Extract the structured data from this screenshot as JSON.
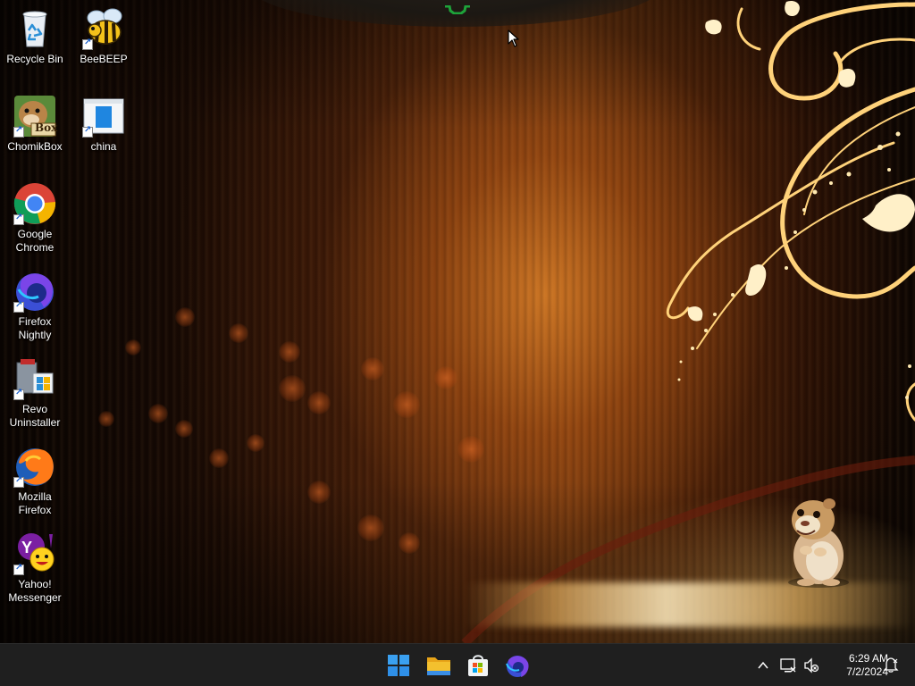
{
  "desktop": {
    "icons": [
      {
        "label": "Recycle Bin",
        "icon": "recycle-bin-icon",
        "shortcut": false
      },
      {
        "label": "BeeBEEP",
        "icon": "bee-icon",
        "shortcut": true
      },
      {
        "label": "ChomikBox",
        "icon": "hamster-box-icon",
        "shortcut": true
      },
      {
        "label": "china",
        "icon": "document-icon",
        "shortcut": true
      },
      {
        "label": "Google\nChrome",
        "icon": "chrome-icon",
        "shortcut": true
      },
      {
        "label": "Firefox\nNightly",
        "icon": "firefox-nightly-icon",
        "shortcut": true
      },
      {
        "label": "Revo\nUninstaller",
        "icon": "revo-uninstaller-icon",
        "shortcut": true
      },
      {
        "label": "Mozilla\nFirefox",
        "icon": "firefox-icon",
        "shortcut": true
      },
      {
        "label": "Yahoo!\nMessenger",
        "icon": "yahoo-messenger-icon",
        "shortcut": true
      }
    ],
    "box_text": "Box"
  },
  "taskbar": {
    "pinned": [
      "start-icon",
      "file-explorer-icon",
      "microsoft-store-icon",
      "firefox-icon"
    ],
    "tray": [
      "chevron-up-icon",
      "network-icon",
      "volume-muted-icon",
      "notification-icon"
    ],
    "time": "6:29 AM",
    "date": "7/2/2024"
  },
  "colors": {
    "taskbar_bg": "#1f1f1f",
    "start_blue": "#3aa0f0",
    "folder_yellow": "#f3c02e"
  }
}
